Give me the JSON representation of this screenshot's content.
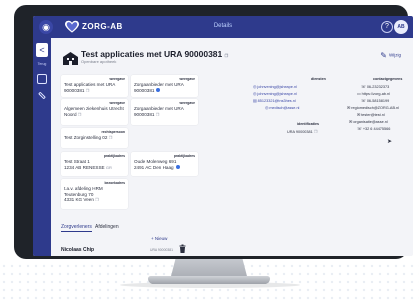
{
  "header": {
    "app_icon": "app-icon",
    "logo_text": "ZORG-AB",
    "title": "Details",
    "help_label": "?",
    "user_initials": "AB"
  },
  "sidebar": {
    "back_glyph": "<",
    "item_label": "Terug"
  },
  "page": {
    "title": "Test applicaties met URA 90000381",
    "subtitle": "Openbare apotheek",
    "edit_label": "Wijzig"
  },
  "cards": {
    "weergave_label": "weergave",
    "c1_value": "Test applicaties met URA 90000381",
    "c2_value": "Zorgaanbieder met URA 90000381",
    "c3_value": "Algemeen ziekenhuis Utrecht Noord",
    "c4_value": "Zorgaanbieder met URA 90000381",
    "rechtspersoon_label": "rechtspersoon",
    "rechtspersoon_value": "Test Zorginstelling 02",
    "praktijkadres_label": "praktijkadres",
    "p1_line1": "Test Straat 1",
    "p1_line2": "1234 AB RENESSE",
    "p1_tag": "GR",
    "p2_line1": "Oude Molenweg 691",
    "p2_line2": "2491 AC Den Haag",
    "bezoekadres_label": "bezoekadres",
    "b_line1": "t.a.v. afdeling HRM",
    "b_line2": "Teutenburg 70",
    "b_line3": "4331 KG Veen"
  },
  "contacts": {
    "diensten_header": "diensten",
    "diensten": [
      "johnvening@jsheape.nl",
      "johnvening@jsheape.nl",
      "85123321@tns3hes.nl",
      "medisch@asse.nl"
    ],
    "identificaties_header": "identificaties",
    "identificaties": [
      "URA 90000381"
    ],
    "contactgegevens_header": "contactgegevens",
    "contactgegevens": [
      "06-23232373",
      "https://zorg-ab.nl",
      "06-58158199",
      "regiomedisch@ZORG-AB.nl",
      "tester@test.nl",
      "organisatie@asse.nl",
      "+32 6 44475566"
    ]
  },
  "tabs": {
    "active": "Zorgverleners",
    "other": "Afdelingen"
  },
  "list": {
    "new_label": "+ Nieuw",
    "rows": [
      {
        "name": "Nicolaas Chip",
        "code": "URA 90000381"
      }
    ]
  },
  "colors": {
    "brand": "#2e3a8c",
    "accent": "#3a6fe0",
    "background": "#f3f4f8"
  }
}
